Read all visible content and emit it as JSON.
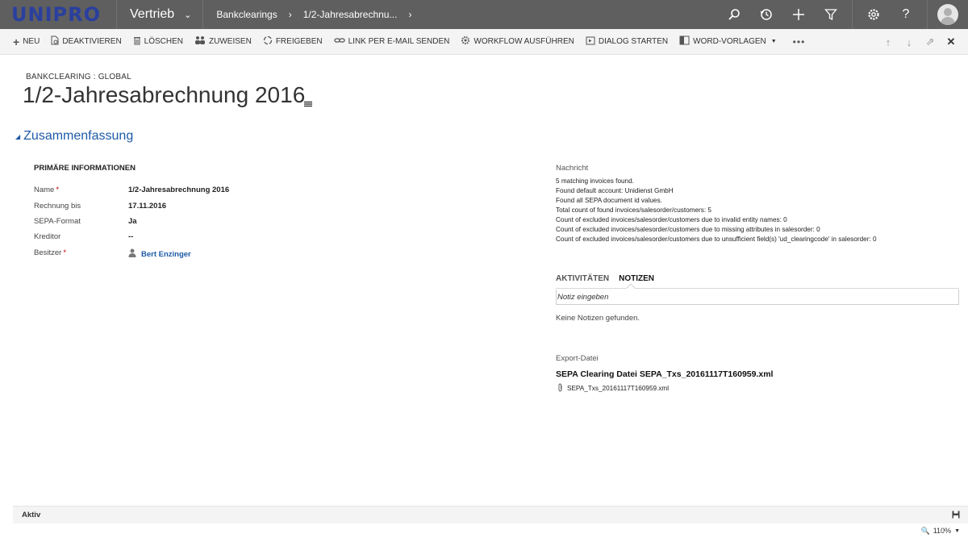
{
  "app": {
    "logo": "UNIPRO",
    "module": "Vertrieb",
    "breadcrumbs": [
      "Bankclearings",
      "1/2-Jahresabrechnu..."
    ]
  },
  "topbar": {
    "icons": [
      "search-icon",
      "history-icon",
      "plus-icon",
      "filter-icon",
      "settings-icon",
      "help-icon",
      "user-avatar"
    ]
  },
  "commands": [
    {
      "label": "NEU",
      "icon": "plus-icon",
      "glyph": "+"
    },
    {
      "label": "DEAKTIVIEREN",
      "icon": "deactivate-icon",
      "glyph": "⊘"
    },
    {
      "label": "LÖSCHEN",
      "icon": "trash-icon",
      "glyph": "🗑"
    },
    {
      "label": "ZUWEISEN",
      "icon": "assign-icon",
      "glyph": "👥"
    },
    {
      "label": "FREIGEBEN",
      "icon": "share-icon",
      "glyph": "⟳"
    },
    {
      "label": "LINK PER E-MAIL SENDEN",
      "icon": "link-icon",
      "glyph": "∞"
    },
    {
      "label": "WORKFLOW AUSFÜHREN",
      "icon": "workflow-icon",
      "glyph": "⚙"
    },
    {
      "label": "DIALOG STARTEN",
      "icon": "dialog-icon",
      "glyph": "▣"
    },
    {
      "label": "WORD-VORLAGEN",
      "icon": "word-icon",
      "glyph": "W",
      "dropdown": true
    }
  ],
  "record": {
    "entity": "BANKCLEARING : GLOBAL",
    "title": "1/2-Jahresabrechnung 2016"
  },
  "section": {
    "title": "Zusammenfassung",
    "group_header": "PRIMÄRE INFORMATIONEN",
    "fields": [
      {
        "label": "Name",
        "required": true,
        "value": "1/2-Jahresabrechnung 2016"
      },
      {
        "label": "Rechnung bis",
        "required": false,
        "value": "17.11.2016"
      },
      {
        "label": "SEPA-Format",
        "required": false,
        "value": "Ja"
      },
      {
        "label": "Kreditor",
        "required": false,
        "value": "--"
      },
      {
        "label": "Besitzer",
        "required": true,
        "value": "Bert Enzinger",
        "lookup": true
      }
    ]
  },
  "message": {
    "label": "Nachricht",
    "lines": [
      "5 matching invoices found.",
      "Found default account: Unidienst GmbH",
      "Found all SEPA document id values.",
      "Total count of found invoices/salesorder/customers: 5",
      "Count of excluded invoices/salesorder/customers due to invalid entity names: 0",
      "Count of excluded invoices/salesorder/customers due to missing attributes in salesorder: 0",
      "Count of excluded invoices/salesorder/customers due to unsufficient field(s) 'ud_clearingcode' in salesorder: 0"
    ]
  },
  "notes": {
    "tabs": [
      "AKTIVITÄTEN",
      "NOTIZEN"
    ],
    "active_tab": 1,
    "input_placeholder": "Notiz eingeben",
    "empty_text": "Keine Notizen gefunden."
  },
  "export": {
    "label": "Export-Datei",
    "title": "SEPA Clearing Datei SEPA_Txs_20161117T160959.xml",
    "file": "SEPA_Txs_20161117T160959.xml"
  },
  "footer": {
    "status": "Aktiv",
    "zoom": "110%"
  }
}
